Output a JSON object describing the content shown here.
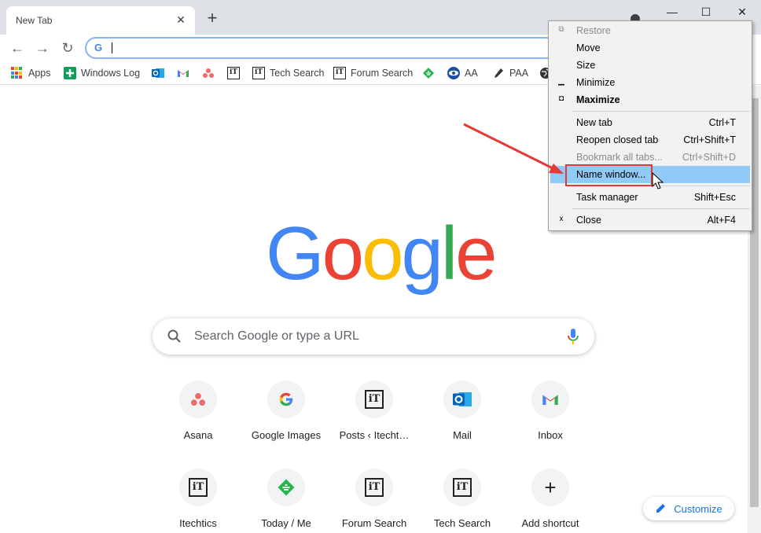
{
  "tab": {
    "title": "New Tab",
    "close": "✕"
  },
  "newtab": "+",
  "window": {
    "minimize": "—",
    "maximize": "☐",
    "close": "✕"
  },
  "toolbar": {
    "back": "←",
    "forward": "→",
    "reload": "↻",
    "omnibox_g": "G",
    "omnibox_value": ""
  },
  "bookmarks": [
    {
      "label": "Apps",
      "icon": "apps-grid-icon"
    },
    {
      "label": "Windows Log",
      "icon": "green-plus-icon"
    },
    {
      "label": "",
      "icon": "outlook-icon"
    },
    {
      "label": "",
      "icon": "gmail-icon"
    },
    {
      "label": "",
      "icon": "asana-icon"
    },
    {
      "label": "",
      "icon": "itechtics-icon"
    },
    {
      "label": "Tech Search",
      "icon": "itechtics-icon"
    },
    {
      "label": "Forum Search",
      "icon": "itechtics-icon"
    },
    {
      "label": "",
      "icon": "feedly-icon"
    },
    {
      "label": "AA",
      "icon": "eye-icon"
    },
    {
      "label": "PAA",
      "icon": "pen-icon"
    },
    {
      "label": "",
      "icon": "globe-icon"
    }
  ],
  "logo": [
    "G",
    "o",
    "o",
    "g",
    "l",
    "e"
  ],
  "search": {
    "placeholder": "Search Google or type a URL"
  },
  "shortcuts": [
    {
      "label": "Asana",
      "icon": "asana-icon"
    },
    {
      "label": "Google Images",
      "icon": "google-g-icon"
    },
    {
      "label": "Posts ‹ Itecht…",
      "icon": "itechtics-icon"
    },
    {
      "label": "Mail",
      "icon": "outlook-icon"
    },
    {
      "label": "Inbox",
      "icon": "gmail-icon"
    },
    {
      "label": "Itechtics",
      "icon": "itechtics-icon"
    },
    {
      "label": "Today / Me",
      "icon": "feedly-icon"
    },
    {
      "label": "Forum Search",
      "icon": "itechtics-icon"
    },
    {
      "label": "Tech Search",
      "icon": "itechtics-icon"
    },
    {
      "label": "Add shortcut",
      "icon": "plus-icon"
    }
  ],
  "it_glyph": "iT",
  "plus_glyph": "+",
  "customize": {
    "label": "Customize"
  },
  "menu": {
    "items": [
      {
        "label": "Restore",
        "shortcut": "",
        "icon": "restore-icon",
        "state": "disabled"
      },
      {
        "label": "Move",
        "shortcut": "",
        "icon": "",
        "state": "normal"
      },
      {
        "label": "Size",
        "shortcut": "",
        "icon": "",
        "state": "normal"
      },
      {
        "label": "Minimize",
        "shortcut": "",
        "icon": "minimize-icon",
        "state": "normal"
      },
      {
        "label": "Maximize",
        "shortcut": "",
        "icon": "maximize-icon",
        "state": "bold"
      },
      {
        "label": "New tab",
        "shortcut": "Ctrl+T",
        "icon": "",
        "state": "normal"
      },
      {
        "label": "Reopen closed tab",
        "shortcut": "Ctrl+Shift+T",
        "icon": "",
        "state": "normal"
      },
      {
        "label": "Bookmark all tabs...",
        "shortcut": "Ctrl+Shift+D",
        "icon": "",
        "state": "disabled"
      },
      {
        "label": "Name window...",
        "shortcut": "",
        "icon": "",
        "state": "highlighted"
      },
      {
        "label": "Task manager",
        "shortcut": "Shift+Esc",
        "icon": "",
        "state": "normal"
      },
      {
        "label": "Close",
        "shortcut": "Alt+F4",
        "icon": "close-x-icon",
        "state": "normal"
      }
    ],
    "glyphs": {
      "restore": "⧉",
      "minimize": "▁",
      "maximize": "◘",
      "close": "x"
    }
  },
  "colors": {
    "accent": "#1a73e8",
    "highlight": "#91c9f7",
    "annotation": "#e53935"
  }
}
